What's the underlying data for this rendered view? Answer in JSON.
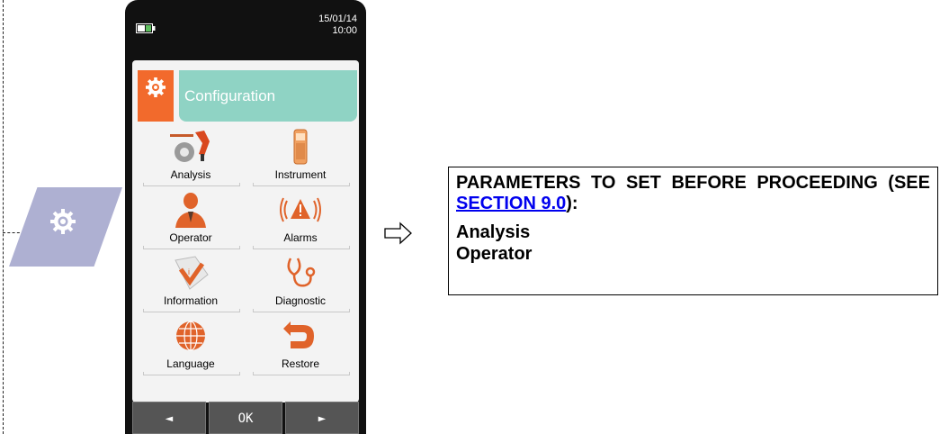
{
  "device": {
    "date": "15/01/14",
    "time": "10:00",
    "menu_title": "Configuration",
    "menu_items": [
      {
        "label": "Analysis",
        "icon": "analysis-icon"
      },
      {
        "label": "Instrument",
        "icon": "instrument-icon"
      },
      {
        "label": "Operator",
        "icon": "operator-icon"
      },
      {
        "label": "Alarms",
        "icon": "alarm-icon"
      },
      {
        "label": "Information",
        "icon": "information-icon"
      },
      {
        "label": "Diagnostic",
        "icon": "stethoscope-icon"
      },
      {
        "label": "Language",
        "icon": "globe-icon"
      },
      {
        "label": "Restore",
        "icon": "restore-icon"
      }
    ],
    "softkeys": {
      "left": "◄",
      "center": "OK",
      "right": "►"
    }
  },
  "note": {
    "heading_part1": "PARAMETERS TO SET BEFORE PROCEEDING (SEE ",
    "link_text": "SECTION 9.0",
    "heading_part2": "):",
    "items": [
      "Analysis",
      "Operator"
    ]
  },
  "colors": {
    "accent_orange": "#f26a2c",
    "header_teal": "#8fd3c4",
    "side_tab": "#aeb0d2",
    "link_blue": "#0000ee"
  }
}
